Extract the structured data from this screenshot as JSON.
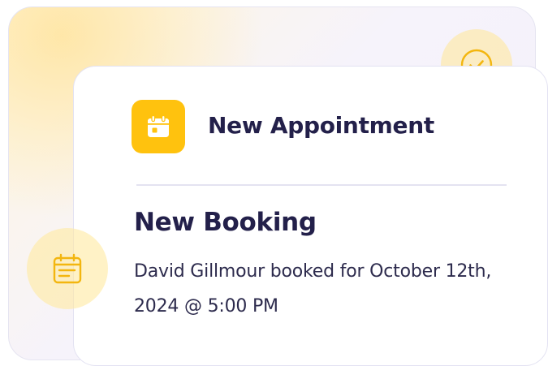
{
  "notification": {
    "header_title": "New Appointment",
    "booking_title": "New Booking",
    "booking_description": "David Gillmour booked for October 12th, 2024 @ 5:00 PM"
  },
  "icons": {
    "app_icon": "calendar-icon",
    "badge_top_right": "check-circle-icon",
    "badge_left": "calendar-list-icon"
  },
  "colors": {
    "accent": "#ffc20e",
    "text_primary": "#23204a",
    "badge_bg": "#fff1c4"
  }
}
